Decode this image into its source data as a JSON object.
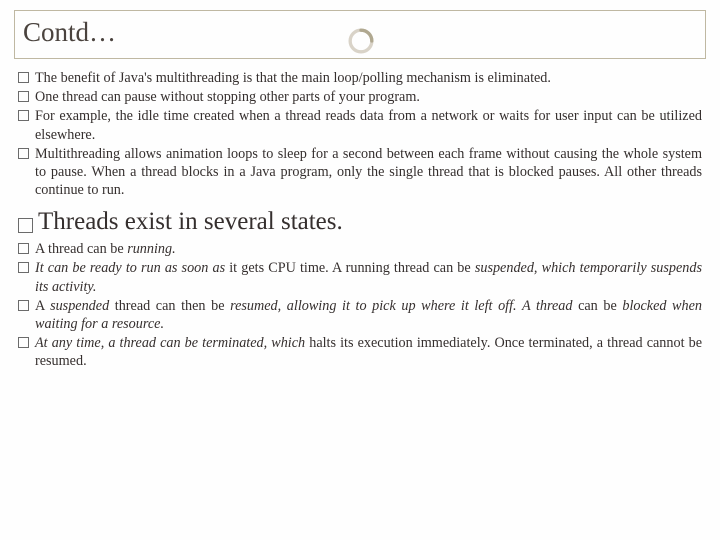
{
  "title": "Contd…",
  "bullets_a": [
    "The benefit of Java's multithreading is that the main loop/polling mechanism is eliminated.",
    "One thread can pause without stopping other parts of your program.",
    "For example, the idle time created when a thread reads data from a network or waits for user input can be utilized elsewhere.",
    "Multithreading allows animation loops to sleep for a second between each frame without causing the whole system to pause. When a thread blocks in a Java program, only the single thread that is blocked pauses. All other threads continue to run."
  ],
  "section_b_title": "Threads exist in several states.",
  "bullets_b": [
    {
      "pre": "A thread can be ",
      "em": "running.",
      "post": ""
    },
    {
      "pre": "",
      "em": "It can be ready to run as soon as",
      "post": " it gets CPU time. A running thread can be ",
      "em2": "suspended, which temporarily suspends its activity."
    },
    {
      "pre": "A ",
      "em": "suspended",
      "post": " thread can then be ",
      "em2": "resumed, allowing it to pick up where it left off. A thread",
      "post2": " can be ",
      "em3": "blocked when waiting for a resource."
    },
    {
      "pre": "",
      "em": "At any time, a thread can be terminated, which",
      "post": " halts its execution immediately. Once terminated, a thread cannot be resumed."
    }
  ]
}
